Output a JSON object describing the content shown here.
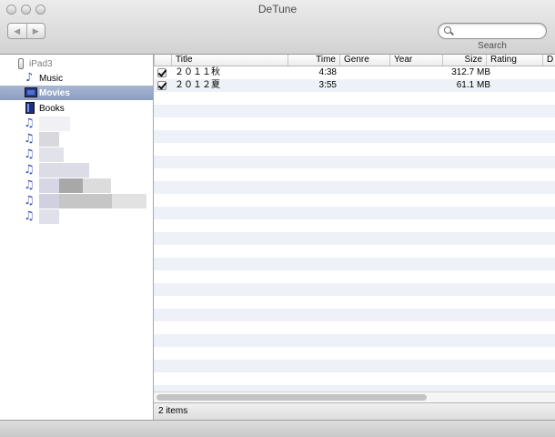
{
  "window": {
    "title": "DeTune"
  },
  "toolbar": {
    "back_icon": "back-arrow-icon",
    "forward_icon": "forward-arrow-icon",
    "search_label": "Search",
    "search_value": ""
  },
  "sidebar": {
    "device": "iPad3",
    "items": [
      {
        "label": "Music",
        "icon": "music-note-icon"
      },
      {
        "label": "Movies",
        "icon": "movie-icon",
        "selected": true
      },
      {
        "label": "Books",
        "icon": "book-icon"
      },
      {
        "label": "",
        "icon": "playlist-icon"
      },
      {
        "label": "",
        "icon": "playlist-icon"
      },
      {
        "label": "",
        "icon": "playlist-icon"
      },
      {
        "label": "",
        "icon": "playlist-icon"
      },
      {
        "label": "",
        "icon": "playlist-icon"
      },
      {
        "label": "",
        "icon": "playlist-icon"
      },
      {
        "label": "",
        "icon": "playlist-icon"
      }
    ]
  },
  "table": {
    "columns": [
      "Title",
      "Time",
      "Genre",
      "Year",
      "Size",
      "Rating",
      "D"
    ],
    "rows": [
      {
        "title": "２０１１秋",
        "time": "4:38",
        "genre": "",
        "year": "",
        "size": "312.7 MB",
        "rating": "",
        "checked": true
      },
      {
        "title": "２０１２夏",
        "time": "3:55",
        "genre": "",
        "year": "",
        "size": "61.1 MB",
        "rating": "",
        "checked": true
      }
    ]
  },
  "status": {
    "items_count": "2 items"
  },
  "colors": {
    "selection": "#8a9cc1",
    "stripe": "#eef2f8",
    "accent": "#3d55b4"
  }
}
